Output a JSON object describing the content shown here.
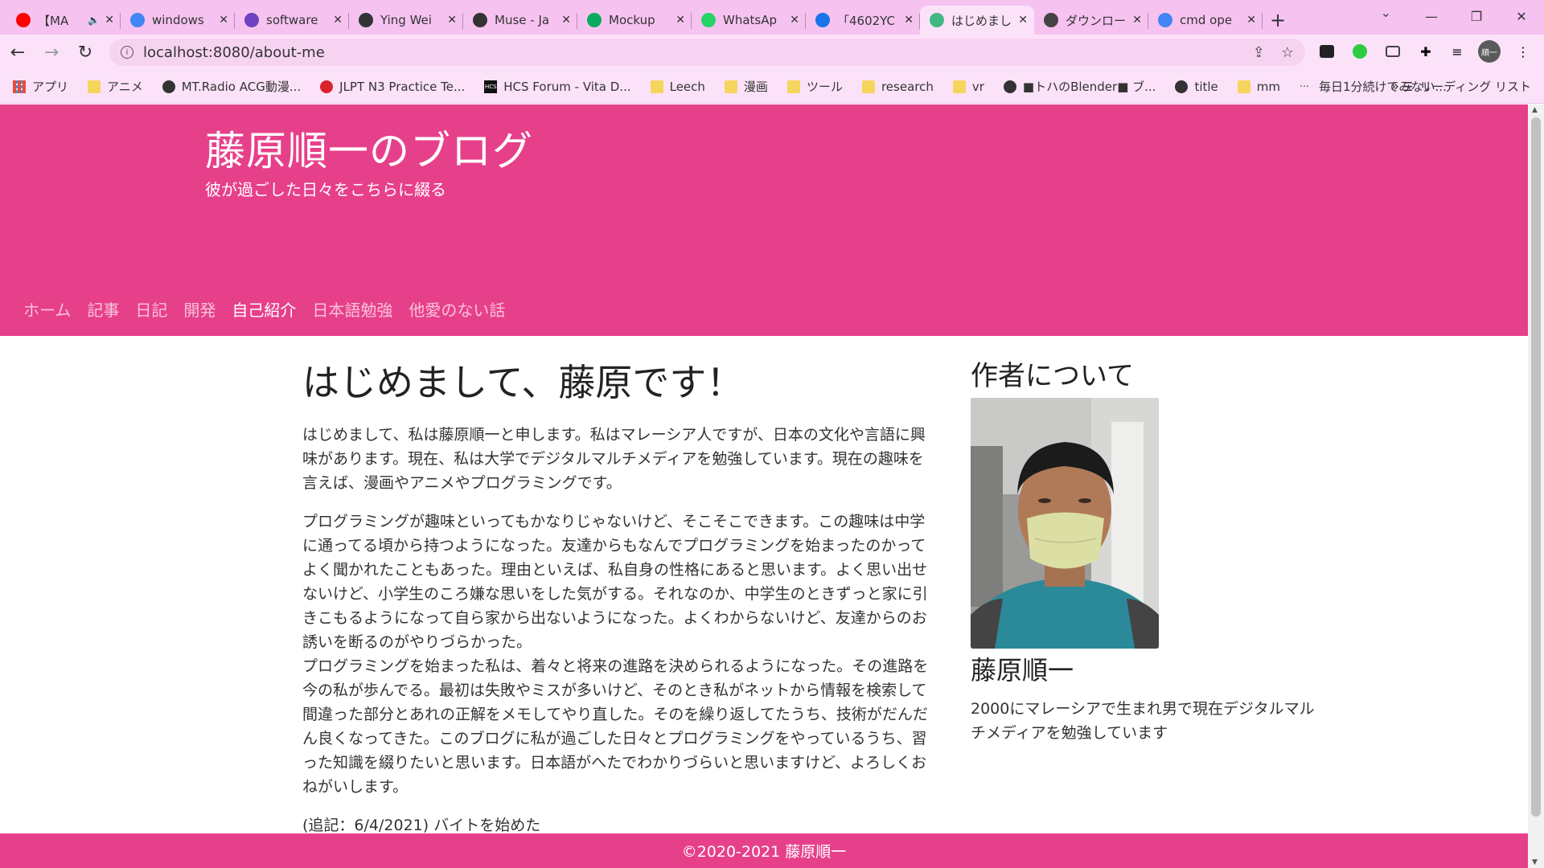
{
  "browser": {
    "tabs": [
      {
        "title": "【MA",
        "icon": "youtube-icon",
        "color": "#ff0000",
        "muted": true
      },
      {
        "title": "windows",
        "icon": "google-icon",
        "color": "#4285f4"
      },
      {
        "title": "software",
        "icon": "bracket-doc-icon",
        "color": "#6f42c1"
      },
      {
        "title": "Ying Wei",
        "icon": "globe-icon",
        "color": "#333333"
      },
      {
        "title": "Muse - Ja",
        "icon": "globe-icon",
        "color": "#333333"
      },
      {
        "title": "Mockup",
        "icon": "px-icon",
        "color": "#0aaa60"
      },
      {
        "title": "WhatsAp",
        "icon": "whatsapp-icon",
        "color": "#25d366"
      },
      {
        "title": "「4602YC",
        "icon": "contact-icon",
        "color": "#1a73e8"
      },
      {
        "title": "はじめまし",
        "icon": "vue-icon",
        "color": "#41b883",
        "active": true
      },
      {
        "title": "ダウンロー",
        "icon": "download-icon",
        "color": "#444444"
      },
      {
        "title": "cmd ope",
        "icon": "google-icon",
        "color": "#4285f4"
      }
    ],
    "url": "localhost:8080/about-me",
    "bookmarks": [
      {
        "label": "アプリ",
        "icon": "apps"
      },
      {
        "label": "アニメ",
        "icon": "folder"
      },
      {
        "label": "MT.Radio ACG動漫...",
        "icon": "globe"
      },
      {
        "label": "JLPT N3 Practice Te...",
        "icon": "red"
      },
      {
        "label": "HCS Forum - Vita D...",
        "icon": "hcs"
      },
      {
        "label": "Leech",
        "icon": "folder"
      },
      {
        "label": "漫画",
        "icon": "folder"
      },
      {
        "label": "ツール",
        "icon": "folder"
      },
      {
        "label": "research",
        "icon": "folder"
      },
      {
        "label": "vr",
        "icon": "folder"
      },
      {
        "label": "■トハのBlender■ ブ...",
        "icon": "globe"
      },
      {
        "label": "title",
        "icon": "globe"
      },
      {
        "label": "mm",
        "icon": "folder"
      },
      {
        "label": "毎日1分続けてみない...",
        "icon": "dots"
      }
    ],
    "reading_list": "リーディング リスト",
    "profile_initials": "順一"
  },
  "site": {
    "title": "藤原順一のブログ",
    "tagline": "彼が過ごした日々をこちらに綴る",
    "nav": [
      {
        "label": "ホーム"
      },
      {
        "label": "記事"
      },
      {
        "label": "日記"
      },
      {
        "label": "開発"
      },
      {
        "label": "自己紹介",
        "active": true
      },
      {
        "label": "日本語勉強"
      },
      {
        "label": "他愛のない話"
      }
    ],
    "accent": "#e7408b"
  },
  "post": {
    "title": "はじめまして、藤原です！",
    "p1": "はじめまして、私は藤原順一と申します。私はマレーシア人ですが、日本の文化や言語に興味があります。現在、私は大学でデジタルマルチメディアを勉強しています。現在の趣味を言えば、漫画やアニメやプログラミングです。",
    "p2": "プログラミングが趣味といってもかなりじゃないけど、そこそこできます。この趣味は中学に通ってる頃から持つようになった。友達からもなんでプログラミングを始まったのかってよく聞かれたこともあった。理由といえば、私自身の性格にあると思います。よく思い出せないけど、小学生のころ嫌な思いをした気がする。それなのか、中学生のときずっと家に引きこもるようになって自ら家から出ないようになった。よくわからないけど、友達からのお誘いを断るのがやりづらかった。",
    "p3": "プログラミングを始まった私は、着々と将来の進路を決められるようになった。その進路を今の私が歩んでる。最初は失敗やミスが多いけど、そのとき私がネットから情報を検索して間違った部分とあれの正解をメモしてやり直した。そのを繰り返してたうち、技術がだんだん良くなってきた。このブログに私が過ごした日々とプログラミングをやっているうち、習った知識を綴りたいと思います。日本語がへたでわかりづらいと思いますけど、よろしくおねがいします。",
    "note": "(追記：6/4/2021) バイトを始めた"
  },
  "sidebar": {
    "title": "作者について",
    "author_name": "藤原順一",
    "bio": "2000にマレーシアで生まれ男で現在デジタルマルチメディアを勉強しています"
  },
  "footer": {
    "text": "©2020-2021 藤原順一"
  }
}
